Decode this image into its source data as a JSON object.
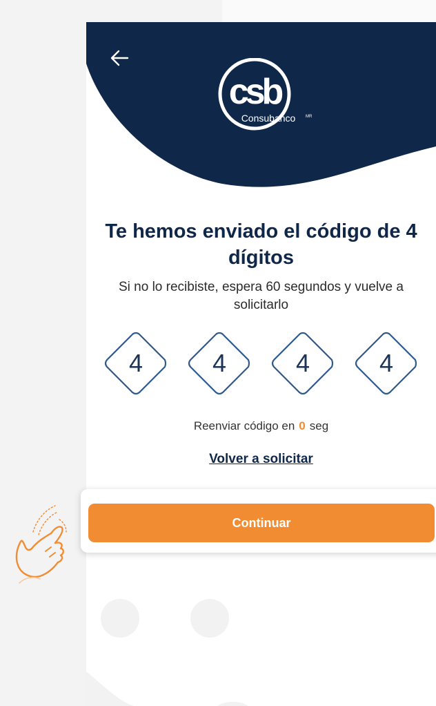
{
  "header": {
    "logo": {
      "text": "csb",
      "brand": "Consubanco",
      "mark": "MR"
    }
  },
  "otp": {
    "title": "Te hemos enviado el código de 4 dígitos",
    "subtitle": "Si no lo recibiste, espera 60 segundos y vuelve a solicitarlo",
    "digits": [
      "4",
      "4",
      "4",
      "4"
    ]
  },
  "resend": {
    "prefix": "Reenviar código en",
    "count": "0",
    "suffix": "seg",
    "link_label": "Volver a solicitar"
  },
  "actions": {
    "continue_label": "Continuar"
  },
  "colors": {
    "navy": "#0f2748",
    "accent": "#f18c33",
    "digit_border": "#2f5a8a"
  },
  "icons": {
    "back": "back-arrow-icon",
    "hint": "tap-hand-icon"
  }
}
